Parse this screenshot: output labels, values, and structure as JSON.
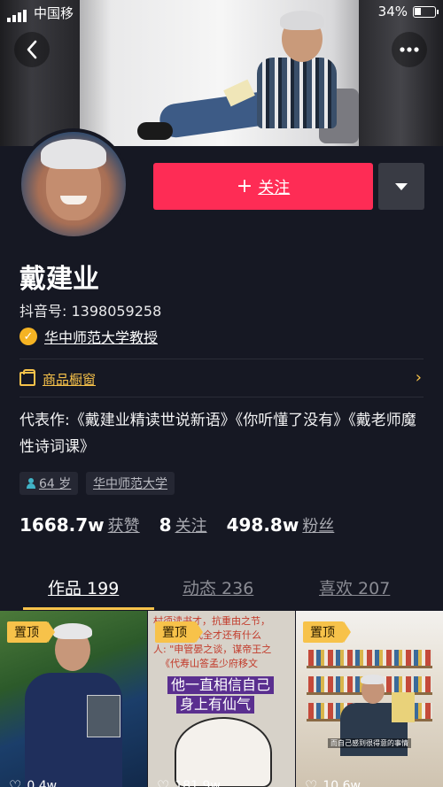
{
  "status": {
    "carrier": "中国移",
    "battery": "34%",
    "battery_level": 0.34
  },
  "profile": {
    "name": "戴建业",
    "douyin_id": "抖音号: 1398059258",
    "verification": "华中师范大学教授",
    "follow_label": "关注",
    "follow_plus": "+",
    "shop_label": "商品橱窗",
    "bio": "代表作:《戴建业精读世说新语》《你听懂了没有》《戴老师魔性诗词课》",
    "tags": {
      "age": "64 岁",
      "school": "华中师范大学"
    }
  },
  "stats": [
    {
      "num": "1668.7w",
      "label": "获赞"
    },
    {
      "num": "8",
      "label": "关注"
    },
    {
      "num": "498.8w",
      "label": "粉丝"
    }
  ],
  "tabs": [
    {
      "label": "作品 199"
    },
    {
      "label": "动态 236"
    },
    {
      "label": "喜欢 207"
    }
  ],
  "videos": [
    {
      "pin": "置顶",
      "likes": "0.4w"
    },
    {
      "pin": "置顶",
      "likes": "181.9w",
      "text_lines": [
        "村须读书才，抗重由之节，",
        "文武全才还有什么",
        "人: \"申管晏之谈，谋帝王之",
        "《代寿山答孟少府移文"
      ],
      "caption": [
        "他一直相信自己",
        "身上有仙气"
      ]
    },
    {
      "pin": "置顶",
      "likes": "10.6w",
      "subtitle": "而自己感到很得意的事情"
    }
  ],
  "colors": {
    "accent": "#fe2c55",
    "pin": "#f7c24a",
    "bg": "#161823"
  }
}
